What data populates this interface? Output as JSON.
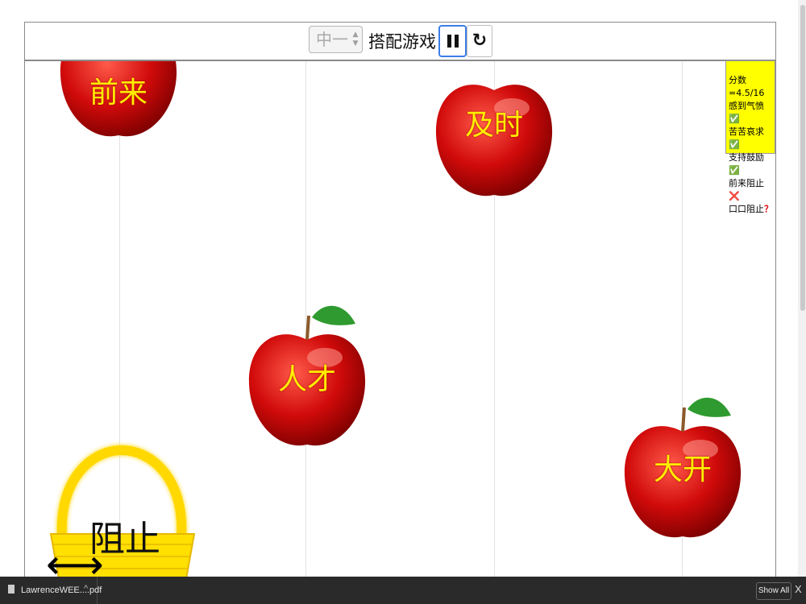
{
  "toolbar": {
    "level_value": "中一",
    "level_arrows": "▲▼",
    "title": "搭配游戏",
    "restart_symbol": "↻"
  },
  "apples": [
    {
      "word": "前来"
    },
    {
      "word": "及时"
    },
    {
      "word": "人才"
    },
    {
      "word": "大开"
    }
  ],
  "basket": {
    "word": "阻止",
    "arrows": "⟷"
  },
  "score_panel": {
    "score": "分数=4.5/16",
    "items": [
      {
        "text": "感到气愤",
        "mark": "✅",
        "color": "#2eb82e"
      },
      {
        "text": "苦苦哀求",
        "mark": "✅",
        "color": "#2eb82e"
      },
      {
        "text": "支持鼓励",
        "mark": "✅",
        "color": "#2eb82e"
      },
      {
        "text": "前来阻止",
        "mark": "❌",
        "color": "#e00000"
      },
      {
        "text": "口口阻止",
        "mark": "？",
        "color": "#e00000"
      }
    ]
  },
  "download_bar": {
    "file_name": "LawrenceWEE....pdf",
    "caret": "^",
    "show_all": "Show All",
    "close": "X"
  },
  "colors": {
    "apple_red": "#c80000",
    "word_yellow": "#ffee00",
    "panel_yellow": "#ffff00",
    "pause_border": "#3c7ee6"
  }
}
